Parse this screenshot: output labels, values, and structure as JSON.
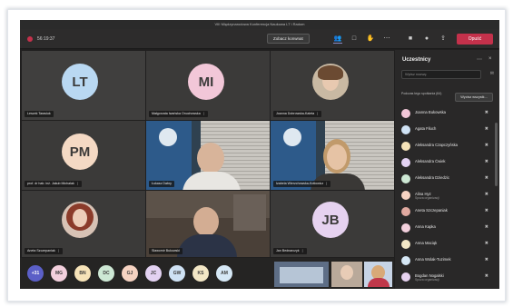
{
  "window": {
    "title": "VIII Międzynarodowa Konferencja Naukowa LT i Radom"
  },
  "toolbar": {
    "time": "56:19:37",
    "raise_hand": "Zobacz konwnat",
    "leave": "Opuść",
    "icons": [
      "participants-icon",
      "chat-icon",
      "raise-hand-icon",
      "more-icon",
      "camera-icon",
      "mic-icon",
      "share-icon"
    ]
  },
  "tiles": [
    {
      "initials": "LT",
      "name": "Leszek Tarasiuk",
      "color": "#b9d8f2"
    },
    {
      "initials": "MI",
      "name": "Małgorzata Iwańska Onuchowska",
      "color": "#f2c7d8"
    },
    {
      "initials": "",
      "name": "Joanna Dobrowska-Kaleta",
      "photo": true
    },
    {
      "initials": "PM",
      "name": "prof. dr hab. inż. Jakub Michalak",
      "color": "#f4d9c4"
    },
    {
      "initials": "",
      "name": "Łukasz Dabry",
      "photo": true
    },
    {
      "initials": "",
      "name": "Izabela Wierzchowska-Kotłowicz",
      "photo": true
    },
    {
      "initials": "",
      "name": "Aneta Szczepaniak",
      "photo": true
    },
    {
      "initials": "",
      "name": "Sławomir Bukowski",
      "photo": true
    },
    {
      "initials": "JB",
      "name": "Jan Bednarczyk",
      "color": "#e6d2f0"
    }
  ],
  "bottom_avatars": [
    {
      "label": "+31",
      "color": "#5b5fc7",
      "fg": "#ffffff"
    },
    {
      "label": "MG",
      "color": "#f3d0dd",
      "fg": "#3b3a39"
    },
    {
      "label": "BN",
      "color": "#f6e3b8",
      "fg": "#3b3a39"
    },
    {
      "label": "DC",
      "color": "#cde8d4",
      "fg": "#3b3a39"
    },
    {
      "label": "GJ",
      "color": "#f6d3c2",
      "fg": "#3b3a39"
    },
    {
      "label": "JC",
      "color": "#e3d2f2",
      "fg": "#3b3a39"
    },
    {
      "label": "GW",
      "color": "#cfe2f4",
      "fg": "#3b3a39"
    },
    {
      "label": "KS",
      "color": "#f3e7c6",
      "fg": "#3b3a39"
    },
    {
      "label": "AM",
      "color": "#d6e8f6",
      "fg": "#3b3a39"
    }
  ],
  "panel": {
    "title": "Uczestnicy",
    "search_placeholder": "Wpisz nazwę",
    "section_label": "Podczas tego spotkania (64)",
    "mute_all": "Wycisz wszystk...",
    "participants": [
      {
        "name": "Joanna Bukowska",
        "color": "#f2c7d8"
      },
      {
        "name": "Agata Filuch",
        "color": "#cfe2f4"
      },
      {
        "name": "Aleksandra Czapczyńska",
        "color": "#f6e3b8"
      },
      {
        "name": "Aleksandra Ćwiek",
        "color": "#e3d2f2"
      },
      {
        "name": "Aleksandra Dziedzic",
        "color": "#cde8d4"
      },
      {
        "name": "Alina Hyz",
        "sub": "Spoza organizacji",
        "color": "#f6d3c2"
      },
      {
        "name": "Aneta Szczepaniak",
        "color": "#e0a9a0"
      },
      {
        "name": "Anna Kapka",
        "color": "#f3d0dd"
      },
      {
        "name": "Anna Maciąk",
        "color": "#f3e7c6"
      },
      {
        "name": "Anna Wolak-Tuzimek",
        "color": "#d6e8f6"
      },
      {
        "name": "Bogdan Nogalski",
        "sub": "Spoza organizacji",
        "color": "#e6d2f0"
      }
    ]
  }
}
